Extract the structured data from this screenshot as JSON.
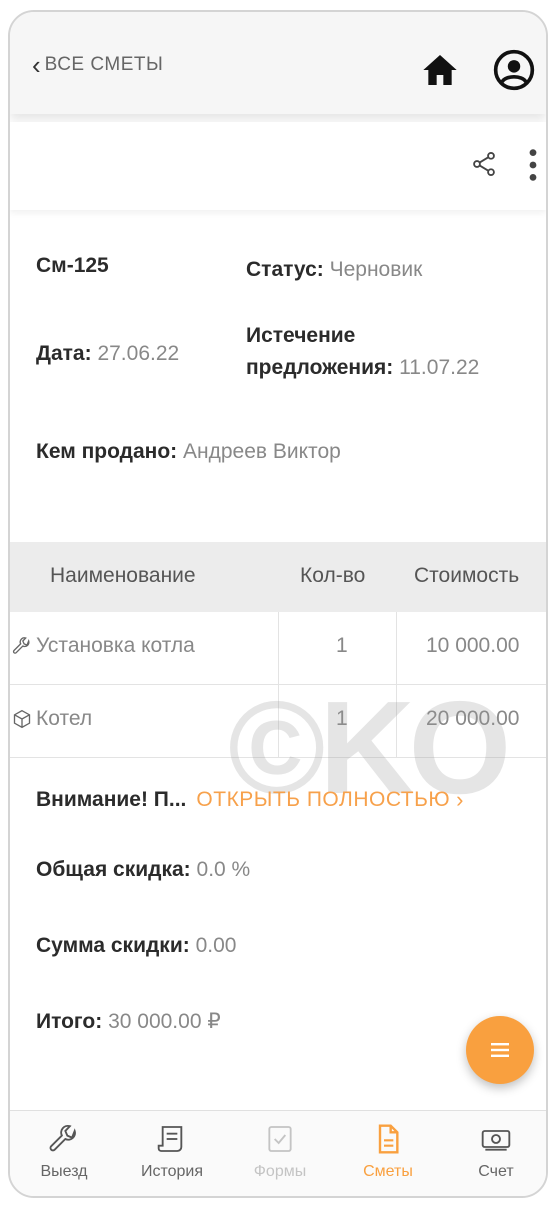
{
  "header": {
    "back_label": "ВСЕ СМЕТЫ"
  },
  "estimate": {
    "number": "См-125",
    "status_label": "Статус:",
    "status_value": "Черновик",
    "date_label": "Дата:",
    "date_value": "27.06.22",
    "expiry_label_1": "Истечение",
    "expiry_label_2": "предложения:",
    "expiry_value": "11.07.22",
    "sold_by_label": "Кем продано:",
    "sold_by_value": "Андреев Виктор"
  },
  "table": {
    "headers": [
      "Наименование",
      "Кол-во",
      "Стоимость"
    ],
    "rows": [
      {
        "icon": "wrench-icon",
        "name": "Установка котла",
        "qty": "1",
        "cost": "10 000.00"
      },
      {
        "icon": "box-icon",
        "name": "Котел",
        "qty": "1",
        "cost": "20 000.00"
      }
    ]
  },
  "details": {
    "notice_label": "Внимание! П...",
    "notice_link": "ОТКРЫТЬ ПОЛНОСТЬЮ",
    "discount_label": "Общая скидка:",
    "discount_value": "0.0 %",
    "discount_sum_label": "Сумма скидки:",
    "discount_sum_value": "0.00",
    "total_label": "Итого:",
    "total_value": "30 000.00 ₽"
  },
  "watermark": "©KO",
  "nav": {
    "items": [
      {
        "label": "Выезд",
        "icon": "wrench-icon",
        "state": "normal"
      },
      {
        "label": "История",
        "icon": "history-icon",
        "state": "normal"
      },
      {
        "label": "Формы",
        "icon": "forms-icon",
        "state": "disabled"
      },
      {
        "label": "Сметы",
        "icon": "document-icon",
        "state": "active"
      },
      {
        "label": "Счет",
        "icon": "money-icon",
        "state": "normal"
      }
    ]
  },
  "colors": {
    "accent": "#f9a03f",
    "link": "#f7a14b",
    "text_muted": "#888888",
    "disabled": "#c4c4c4"
  }
}
